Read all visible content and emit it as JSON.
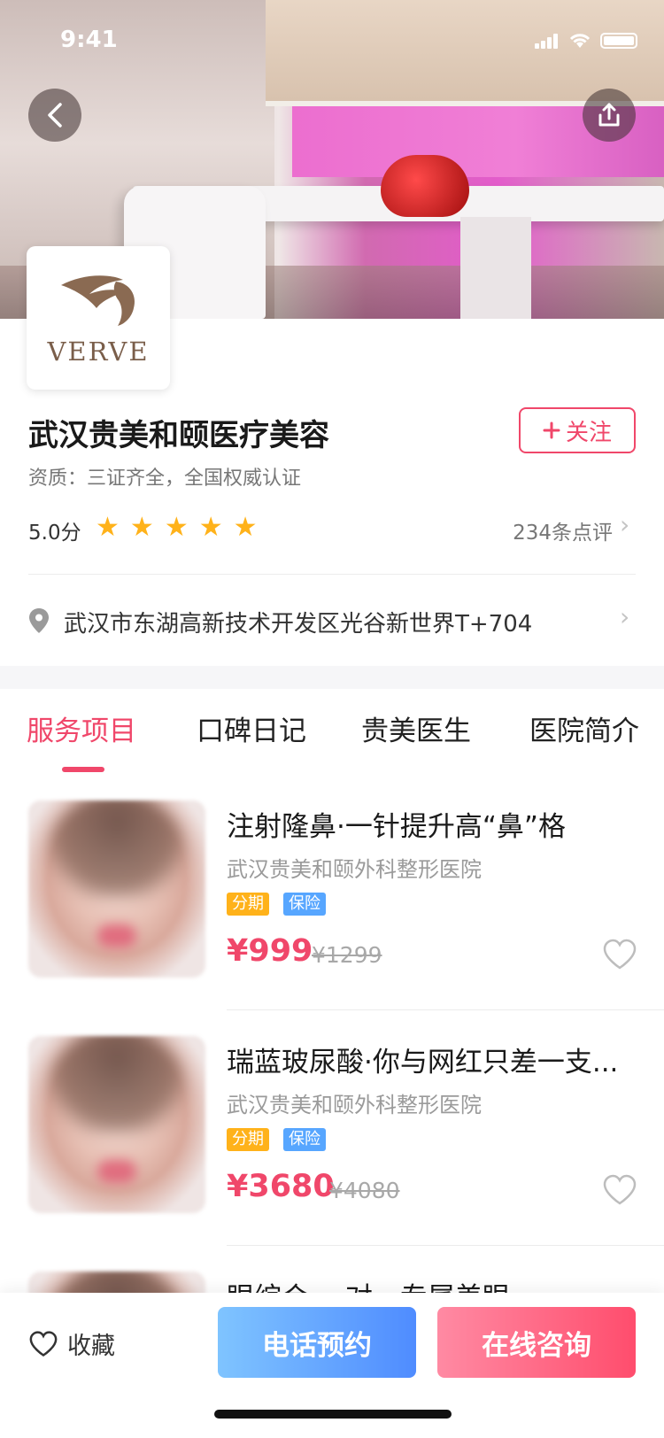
{
  "status_bar": {
    "time": "9:41"
  },
  "header": {
    "logo_text": "VERVE"
  },
  "clinic": {
    "name": "武汉贵美和颐医疗美容",
    "follow_label": "关注",
    "qualification": "资质：三证齐全，全国权威认证",
    "score": "5.0分",
    "rating": 5,
    "reviews": "234条点评",
    "address": "武汉市东湖高新技术开发区光谷新世界T+704"
  },
  "tabs": [
    {
      "label": "服务项目",
      "active": true
    },
    {
      "label": "口碑日记",
      "active": false
    },
    {
      "label": "贵美医生",
      "active": false
    },
    {
      "label": "医院简介",
      "active": false
    }
  ],
  "services": [
    {
      "title": "注射隆鼻·一针提升高“鼻”格",
      "hospital": "武汉贵美和颐外科整形医院",
      "tags": [
        "分期",
        "保险"
      ],
      "price": "¥999",
      "original_price": "¥1299"
    },
    {
      "title": "瑞蓝玻尿酸·你与网红只差一支...",
      "hospital": "武汉贵美和颐外科整形医院",
      "tags": [
        "分期",
        "保险"
      ],
      "price": "¥3680",
      "original_price": "¥4080"
    },
    {
      "title": "眼综合·一对一专属美眼"
    }
  ],
  "bottom_bar": {
    "favorite_label": "收藏",
    "phone_label": "电话预约",
    "consult_label": "在线咨询"
  },
  "colors": {
    "accent": "#f0476a",
    "star": "#ffb21a",
    "installment_tag": "#ffb21a",
    "insurance_tag": "#57a6ff",
    "phone_button": "#4f8cff",
    "consult_button": "#ff4d6d"
  }
}
